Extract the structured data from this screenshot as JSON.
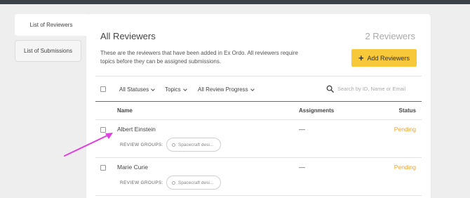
{
  "sidebar": {
    "items": [
      {
        "label": "List of Reviewers"
      },
      {
        "label": "List of Submissions"
      }
    ]
  },
  "panel": {
    "title": "All Reviewers",
    "count": "2 Reviewers",
    "description": "These are the reviewers that have been added in Ex Ordo. All reviewers require topics before they can be assigned submissions.",
    "add_button_label": "Add Reviewers",
    "add_button_icon": "plus-icon"
  },
  "filters": {
    "statuses": "All Statuses",
    "topics": "Topics",
    "review_progress": "All Review Progress",
    "search_placeholder": "Search by ID, Name or Email"
  },
  "table": {
    "headers": {
      "name": "Name",
      "assignments": "Assignments",
      "status": "Status"
    },
    "rows": [
      {
        "name": "Albert Einstein",
        "assignments": "—",
        "status": "Pending",
        "groups_label": "REVIEW GROUPS:",
        "group_chip": "Spacecraft desi..."
      },
      {
        "name": "Marie Curie",
        "assignments": "—",
        "status": "Pending",
        "groups_label": "REVIEW GROUPS:",
        "group_chip": "Spacecraft desi..."
      }
    ]
  },
  "colors": {
    "accent": "#f6c83a",
    "status_pending": "#f0a334",
    "annotation_arrow": "#e040e0",
    "topbar": "#3c4148"
  }
}
